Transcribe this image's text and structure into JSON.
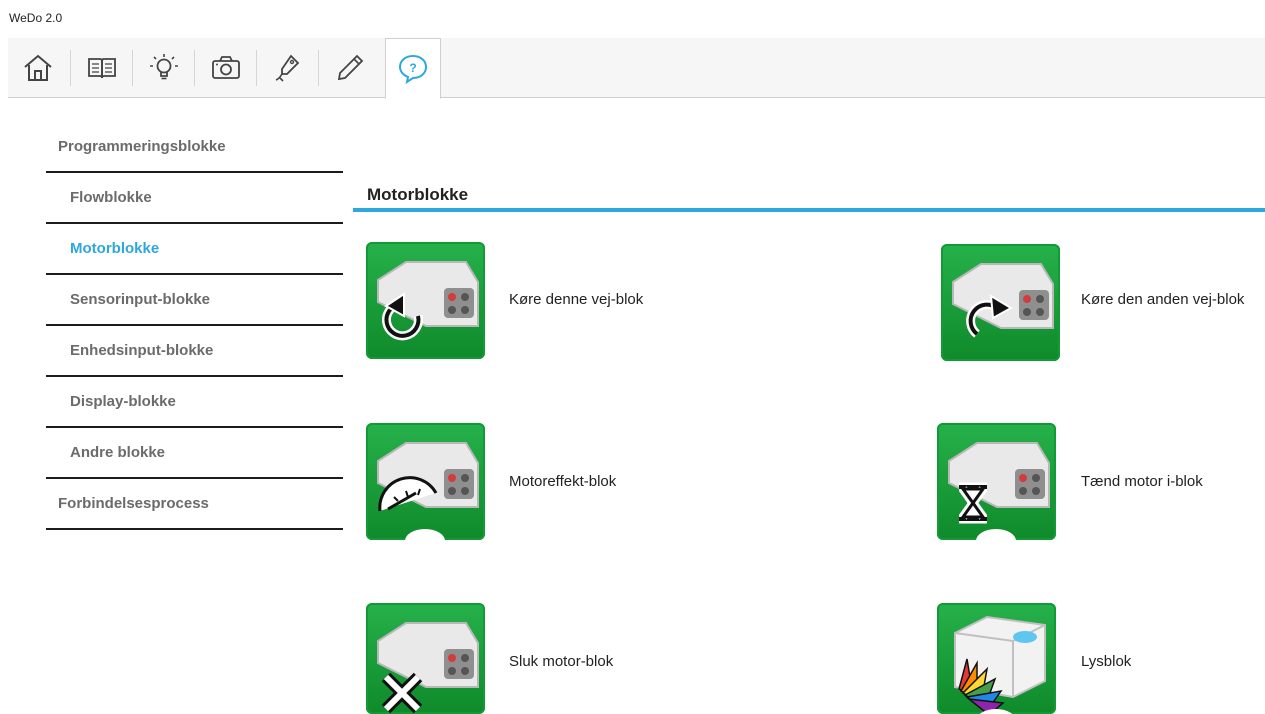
{
  "app": {
    "title": "WeDo 2.0"
  },
  "toolbar": {
    "items": [
      {
        "name": "home",
        "icon": "home-icon"
      },
      {
        "name": "book",
        "icon": "book-icon"
      },
      {
        "name": "ideas",
        "icon": "lightbulb-icon"
      },
      {
        "name": "camera",
        "icon": "camera-icon"
      },
      {
        "name": "design",
        "icon": "pen-tool-icon"
      },
      {
        "name": "edit",
        "icon": "pencil-icon"
      },
      {
        "name": "help",
        "icon": "help-icon",
        "active": true
      }
    ],
    "accent": "#2ea8dc"
  },
  "sidebar": {
    "items": [
      {
        "label": "Programmeringsblokke",
        "level": "top"
      },
      {
        "label": "Flowblokke",
        "level": "sub"
      },
      {
        "label": "Motorblokke",
        "level": "sub",
        "active": true
      },
      {
        "label": "Sensorinput-blokke",
        "level": "sub"
      },
      {
        "label": "Enhedsinput-blokke",
        "level": "sub"
      },
      {
        "label": "Display-blokke",
        "level": "sub"
      },
      {
        "label": "Andre blokke",
        "level": "sub"
      },
      {
        "label": "Forbindelsesprocess",
        "level": "top"
      }
    ]
  },
  "main": {
    "title": "Motorblokke",
    "blocks": [
      {
        "label": "Køre denne vej-blok",
        "icon": "motor-counterclockwise-icon"
      },
      {
        "label": "Køre den anden vej-blok",
        "icon": "motor-clockwise-icon"
      },
      {
        "label": "Motoreffekt-blok",
        "icon": "motor-power-icon"
      },
      {
        "label": "Tænd motor i-blok",
        "icon": "motor-timer-icon"
      },
      {
        "label": "Sluk motor-blok",
        "icon": "motor-stop-icon"
      },
      {
        "label": "Lysblok",
        "icon": "light-color-icon"
      }
    ]
  },
  "colors": {
    "tile_green": "#1fa443",
    "active_blue": "#2ea8dc"
  }
}
